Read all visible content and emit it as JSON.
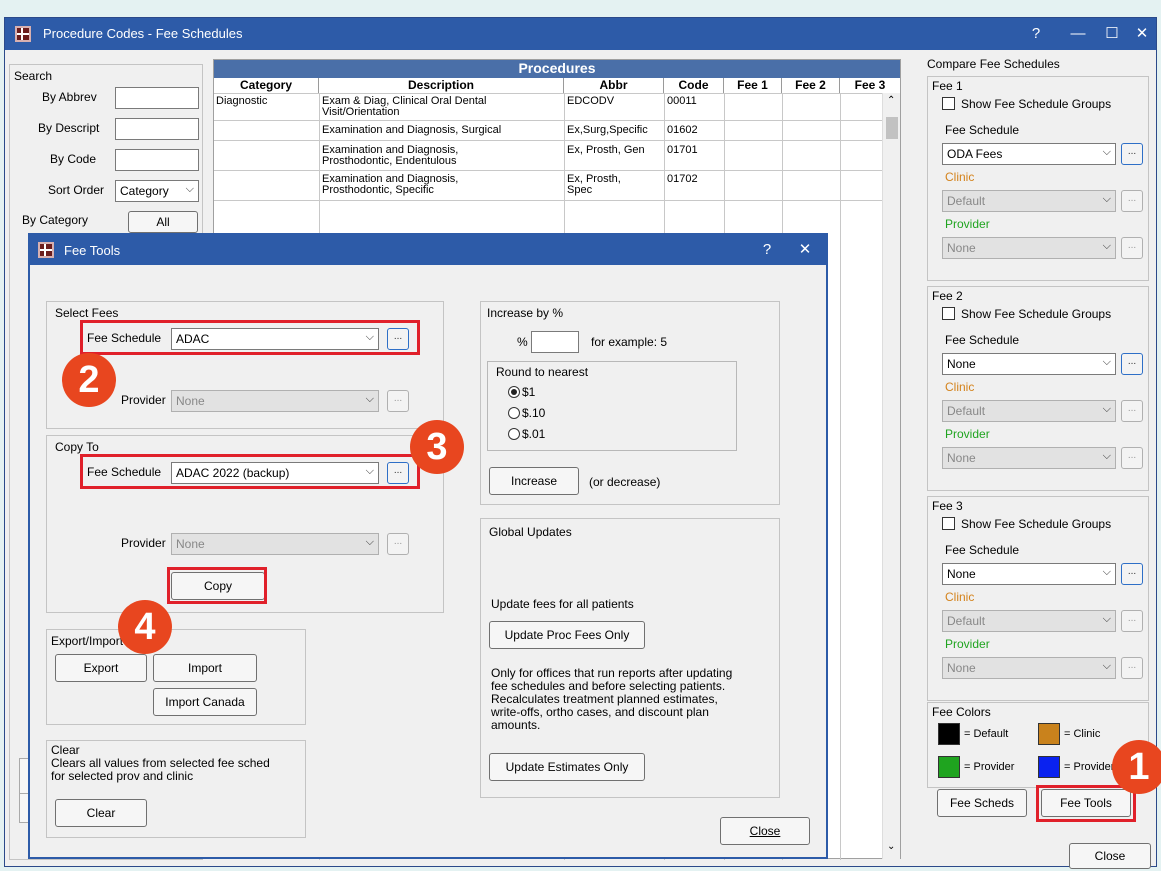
{
  "main_window": {
    "title": "Procedure Codes - Fee Schedules",
    "controls": {
      "help": "?",
      "minimize": "—",
      "maximize": "☐",
      "close": "✕"
    }
  },
  "search": {
    "title": "Search",
    "by_abbrev": "By Abbrev",
    "by_descript": "By Descript",
    "by_code": "By Code",
    "sort_order": "Sort Order",
    "sort_value": "Category",
    "by_category": "By Category",
    "all_button": "All"
  },
  "procedures": {
    "header": "Procedures",
    "columns": [
      "Category",
      "Description",
      "Abbr",
      "Code",
      "Fee 1",
      "Fee 2",
      "Fee 3"
    ],
    "rows": [
      {
        "category": "Diagnostic",
        "description": "Exam & Diag, Clinical Oral Dental Visit/Orientation",
        "abbr": "EDCODV",
        "code": "00011"
      },
      {
        "category": "",
        "description": "Examination and Diagnosis, Surgical",
        "abbr": "Ex,Surg,Specific",
        "code": "01602"
      },
      {
        "category": "",
        "description": "Examination and Diagnosis, Prosthodontic, Endentulous",
        "abbr": "Ex, Prosth, Gen",
        "code": "01701"
      },
      {
        "category": "",
        "description": "Examination and Diagnosis, Prosthodontic, Specific",
        "abbr": "Ex, Prosth, Spec",
        "code": "01702"
      }
    ]
  },
  "compare": {
    "title": "Compare Fee Schedules",
    "fee1": {
      "title": "Fee 1",
      "show_groups": "Show Fee Schedule Groups",
      "fee_schedule_label": "Fee Schedule",
      "fee_schedule": "ODA Fees",
      "clinic_label": "Clinic",
      "clinic": "Default",
      "provider_label": "Provider",
      "provider": "None"
    },
    "fee2": {
      "title": "Fee 2",
      "show_groups": "Show Fee Schedule Groups",
      "fee_schedule_label": "Fee Schedule",
      "fee_schedule": "None",
      "clinic_label": "Clinic",
      "clinic": "Default",
      "provider_label": "Provider",
      "provider": "None"
    },
    "fee3": {
      "title": "Fee 3",
      "show_groups": "Show Fee Schedule Groups",
      "fee_schedule_label": "Fee Schedule",
      "fee_schedule": "None",
      "clinic_label": "Clinic",
      "clinic": "Default",
      "provider_label": "Provider",
      "provider": "None"
    },
    "fee_colors": {
      "title": "Fee Colors",
      "default": "= Default",
      "clinic": "= Clinic",
      "provider1": "= Provider",
      "provider2": "= Provider"
    },
    "fee_scheds_button": "Fee Scheds",
    "fee_tools_button": "Fee Tools",
    "close_button": "Close"
  },
  "fee_tools": {
    "title": "Fee Tools",
    "controls": {
      "help": "?",
      "close": "✕"
    },
    "select_fees": {
      "title": "Select Fees",
      "fee_schedule_label": "Fee Schedule",
      "fee_schedule": "ADAC",
      "provider_label": "Provider",
      "provider": "None"
    },
    "copy_to": {
      "title": "Copy To",
      "fee_schedule_label": "Fee Schedule",
      "fee_schedule": "ADAC 2022 (backup)",
      "provider_label": "Provider",
      "provider": "None",
      "copy_button": "Copy"
    },
    "export_import": {
      "title": "Export/Import",
      "export": "Export",
      "import": "Import",
      "import_canada": "Import Canada"
    },
    "clear": {
      "title": "Clear",
      "description": "Clears all values from selected fee sched for selected prov and clinic",
      "button": "Clear"
    },
    "increase": {
      "title": "Increase by %",
      "percent": "%",
      "example": "for example: 5",
      "round_title": "Round to nearest",
      "options": [
        "$1",
        "$.10",
        "$.01"
      ],
      "button": "Increase",
      "note": "(or decrease)"
    },
    "global": {
      "title": "Global Updates",
      "all_patients": "Update fees for all patients",
      "proc_button": "Update Proc Fees Only",
      "offices_note": "Only for offices that run reports after updating fee schedules and before selecting patients. Recalculates treatment planned estimates, write-offs, ortho cases, and discount plan amounts.",
      "estimates_button": "Update Estimates Only"
    },
    "close_button": "Close",
    "dots": "..."
  },
  "badges": [
    "1",
    "2",
    "3",
    "4"
  ],
  "colors": {
    "title_bar": "#2d5ba8",
    "highlight": "#e0202a",
    "badge": "#e8461f",
    "clinic_label": "#d4831c",
    "provider_label": "#1fa41f"
  }
}
